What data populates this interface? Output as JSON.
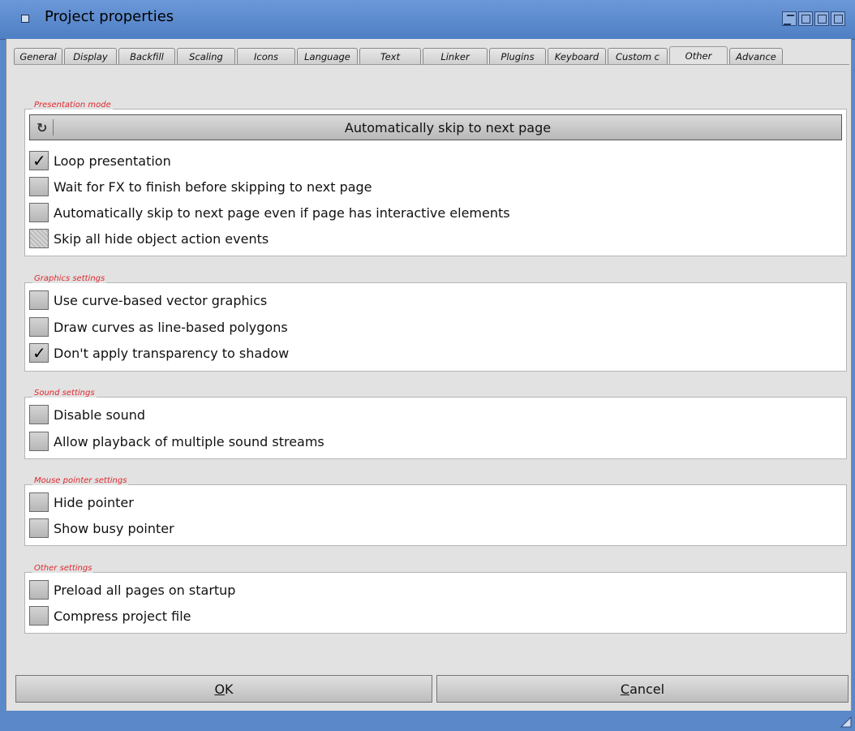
{
  "window": {
    "title": "Project properties"
  },
  "tabs": [
    "General",
    "Display",
    "Backfill",
    "Scaling",
    "Icons",
    "Language",
    "Text",
    "Linker",
    "Plugins",
    "Keyboard",
    "Custom c",
    "Other",
    "Advance"
  ],
  "active_tab": "Other",
  "presentation": {
    "label": "Presentation mode",
    "cycle_value": "Automatically skip to next page",
    "options": [
      {
        "label": "Loop presentation",
        "state": "checked"
      },
      {
        "label": "Wait for FX to finish before skipping to next page",
        "state": "unchecked"
      },
      {
        "label": "Automatically skip to next page even if page has interactive elements",
        "state": "unchecked"
      },
      {
        "label": "Skip all hide object action events",
        "state": "disabled"
      }
    ]
  },
  "graphics": {
    "label": "Graphics settings",
    "options": [
      {
        "label": "Use curve-based vector graphics",
        "state": "unchecked"
      },
      {
        "label": "Draw curves as line-based polygons",
        "state": "unchecked"
      },
      {
        "label": "Don't apply transparency to shadow",
        "state": "checked"
      }
    ]
  },
  "sound": {
    "label": "Sound settings",
    "options": [
      {
        "label": "Disable sound",
        "state": "unchecked"
      },
      {
        "label": "Allow playback of multiple sound streams",
        "state": "unchecked"
      }
    ]
  },
  "mouse": {
    "label": "Mouse pointer settings",
    "options": [
      {
        "label": "Hide pointer",
        "state": "unchecked"
      },
      {
        "label": "Show busy pointer",
        "state": "unchecked"
      }
    ]
  },
  "other": {
    "label": "Other settings",
    "options": [
      {
        "label": "Preload all pages on startup",
        "state": "unchecked"
      },
      {
        "label": "Compress project file",
        "state": "unchecked"
      }
    ]
  },
  "buttons": {
    "ok_key": "O",
    "ok_rest": "K",
    "cancel_key": "C",
    "cancel_rest": "ancel"
  }
}
